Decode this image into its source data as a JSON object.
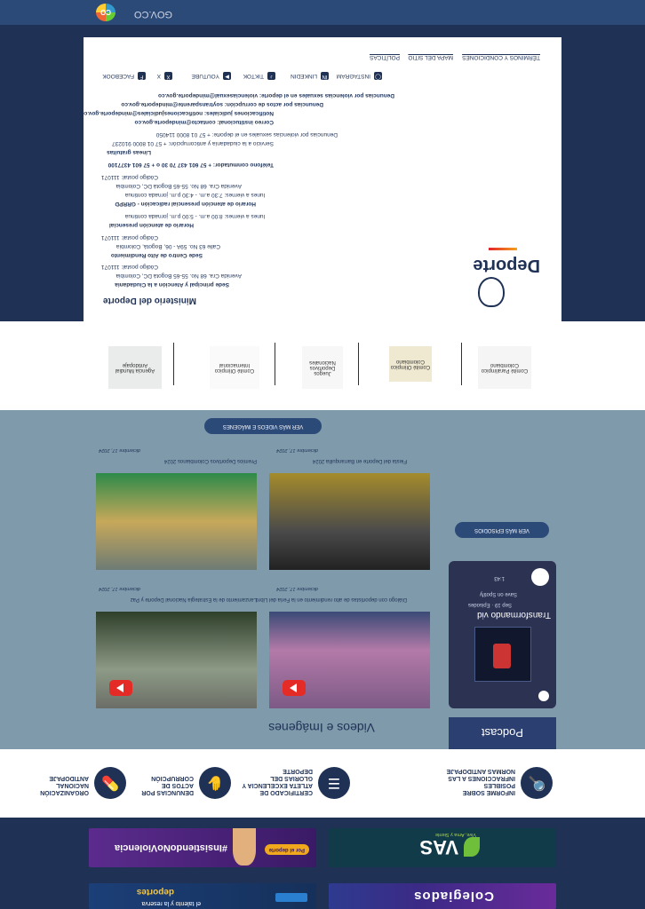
{
  "govbar": {
    "badge": "CO",
    "domain": "GOV.CO"
  },
  "banners": [
    {
      "title": "Colegiados",
      "tag": ""
    },
    {
      "title": "deportes",
      "tag": "el talento y la reserva"
    },
    {
      "title": "#InsistiendoNoViolencia",
      "tag": "Por el deporte"
    },
    {
      "title": "VAS",
      "tag": "Vive, Ama y Siente"
    }
  ],
  "services": [
    {
      "label": "INFORME SOBRE POSIBLES INFRACCIONES A LAS NORMAS ANTIDOPAJE"
    },
    {
      "label": "CERTIFICADO DE ATLETA EXCELENCIA Y GLORIAS DEL DEPORTE"
    },
    {
      "label": "DENUNCIAS POR ACTOS DE CORRUPCIÓN"
    },
    {
      "label": "ORGANIZACIÓN NACIONAL ANTIDOPAJE"
    }
  ],
  "media": {
    "podcast_title": "Podcast",
    "videos_title": "Videos e Imágenes",
    "podcast_show": "Transformando vid",
    "podcast_ep": "Sep 19 · Episodes",
    "podcast_follow": "Save on Spotify",
    "podcast_duration": "1:43",
    "see_podcast": "VER MÁS EPISODIOS",
    "see_videos": "VER MÁS VIDEOS E IMÁGENES",
    "videos": [
      {
        "caption": "Diálogo con deportistas de alto rendimiento en la Feria del Libro",
        "date": "diciembre 17, 2024"
      },
      {
        "caption": "Lanzamiento de la Estrategia Nacional Deporte y Paz",
        "date": "diciembre 17, 2024"
      },
      {
        "caption": "Fiesta del Deporte en Barranquilla 2024",
        "date": "diciembre 17, 2024"
      },
      {
        "caption": "Premios Deportivos Colombianos 2024",
        "date": "diciembre 17, 2024"
      }
    ]
  },
  "partners": [
    {
      "name": "Agencia Mundial Antidopaje"
    },
    {
      "name": "Comité Olímpico Internacional"
    },
    {
      "name": "Juegos Deportivos Nacionales"
    },
    {
      "name": "Comité Olímpico Colombiano"
    },
    {
      "name": "Comité Paralímpico Colombiano"
    }
  ],
  "footer": {
    "brand": "Deporte",
    "ministry": "Ministerio del Deporte",
    "top_links": [
      "POLÍTICAS",
      "MAPA DEL SITIO",
      "TÉRMINOS Y CONDICIONES"
    ],
    "lines": [
      "Sede principal y Atención a la Ciudadanía",
      "Avenida Cra. 68 No. 55-65 Bogotá DC, Colombia",
      "Código postal: 111071",
      "Sede Centro de Alto Rendimiento",
      "Calle 63 No. 59A - 06, Bogotá, Colombia",
      "Código postal: 111071",
      "Horario de atención presencial",
      "lunes a viernes: 8:00 a.m. - 5:00 p.m. jornada continua",
      "Horario de atención presencial radicación - GRRPD",
      "lunes a viernes: 7:30 a.m. - 4:30 p.m. jornada continua",
      "Avenida Cra. 68 No. 55-65 Bogotá DC, Colombia",
      "Código postal: 111071",
      "Teléfono conmutador: + 57 601 437 70 30 o + 57 601 4377100",
      "Líneas gratuitas",
      "Servicio a la ciudadanía y anticorrupción: + 57 01 8000 910237",
      "Denuncias por violencias sexuales en el deporte: + 57 01 8000 114050",
      "Correo institucional: contacto@mindeporte.gov.co",
      "Notificaciones judiciales: notificacionesjudiciales@mindeporte.gov.co",
      "Denuncias por actos de corrupción: soytransparente@mindeporte.gov.co",
      "Denuncias por violencias sexuales en el deporte: violenciasexual@mindeporte.gov.co"
    ],
    "social": [
      "FACEBOOK",
      "X",
      "YOUTUBE",
      "TIKTOK",
      "LINKEDIN",
      "INSTAGRAM"
    ]
  },
  "colors": {
    "navy": "#1f3256",
    "steel": "#7f9aab",
    "white": "#ffffff"
  }
}
